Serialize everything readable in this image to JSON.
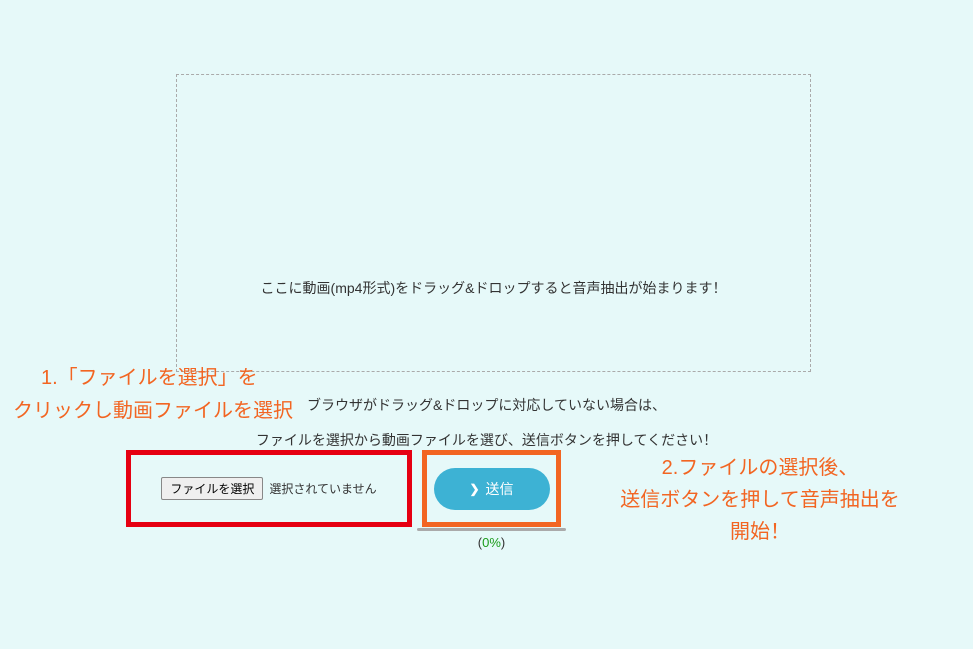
{
  "dropzone": {
    "instruction": "ここに動画(mp4形式)をドラッグ&ドロップすると音声抽出が始まります！"
  },
  "fallback": {
    "line1": "ブラウザがドラッグ&ドロップに対応していない場合は、",
    "line2": "ファイルを選択から動画ファイルを選び、送信ボタンを押してください！"
  },
  "annotations": {
    "step1_line1": "1.「ファイルを選択」を",
    "step1_line2": "クリックし動画ファイルを選択",
    "step2_line1": "2.ファイルの選択後、",
    "step2_line2": "送信ボタンを押して音声抽出を",
    "step2_line3": "開始！"
  },
  "file_select": {
    "button_label": "ファイルを選択",
    "status": "選択されていません"
  },
  "submit": {
    "label": "送信"
  },
  "progress": {
    "open_paren": "(",
    "percent": "0%",
    "close_paren": ")"
  },
  "colors": {
    "background": "#e6f9f9",
    "annotation": "#f26522",
    "red_box": "#e60012",
    "orange_box": "#f26522",
    "submit_bg": "#3db2d4",
    "progress_pct": "#1a9b1a"
  }
}
